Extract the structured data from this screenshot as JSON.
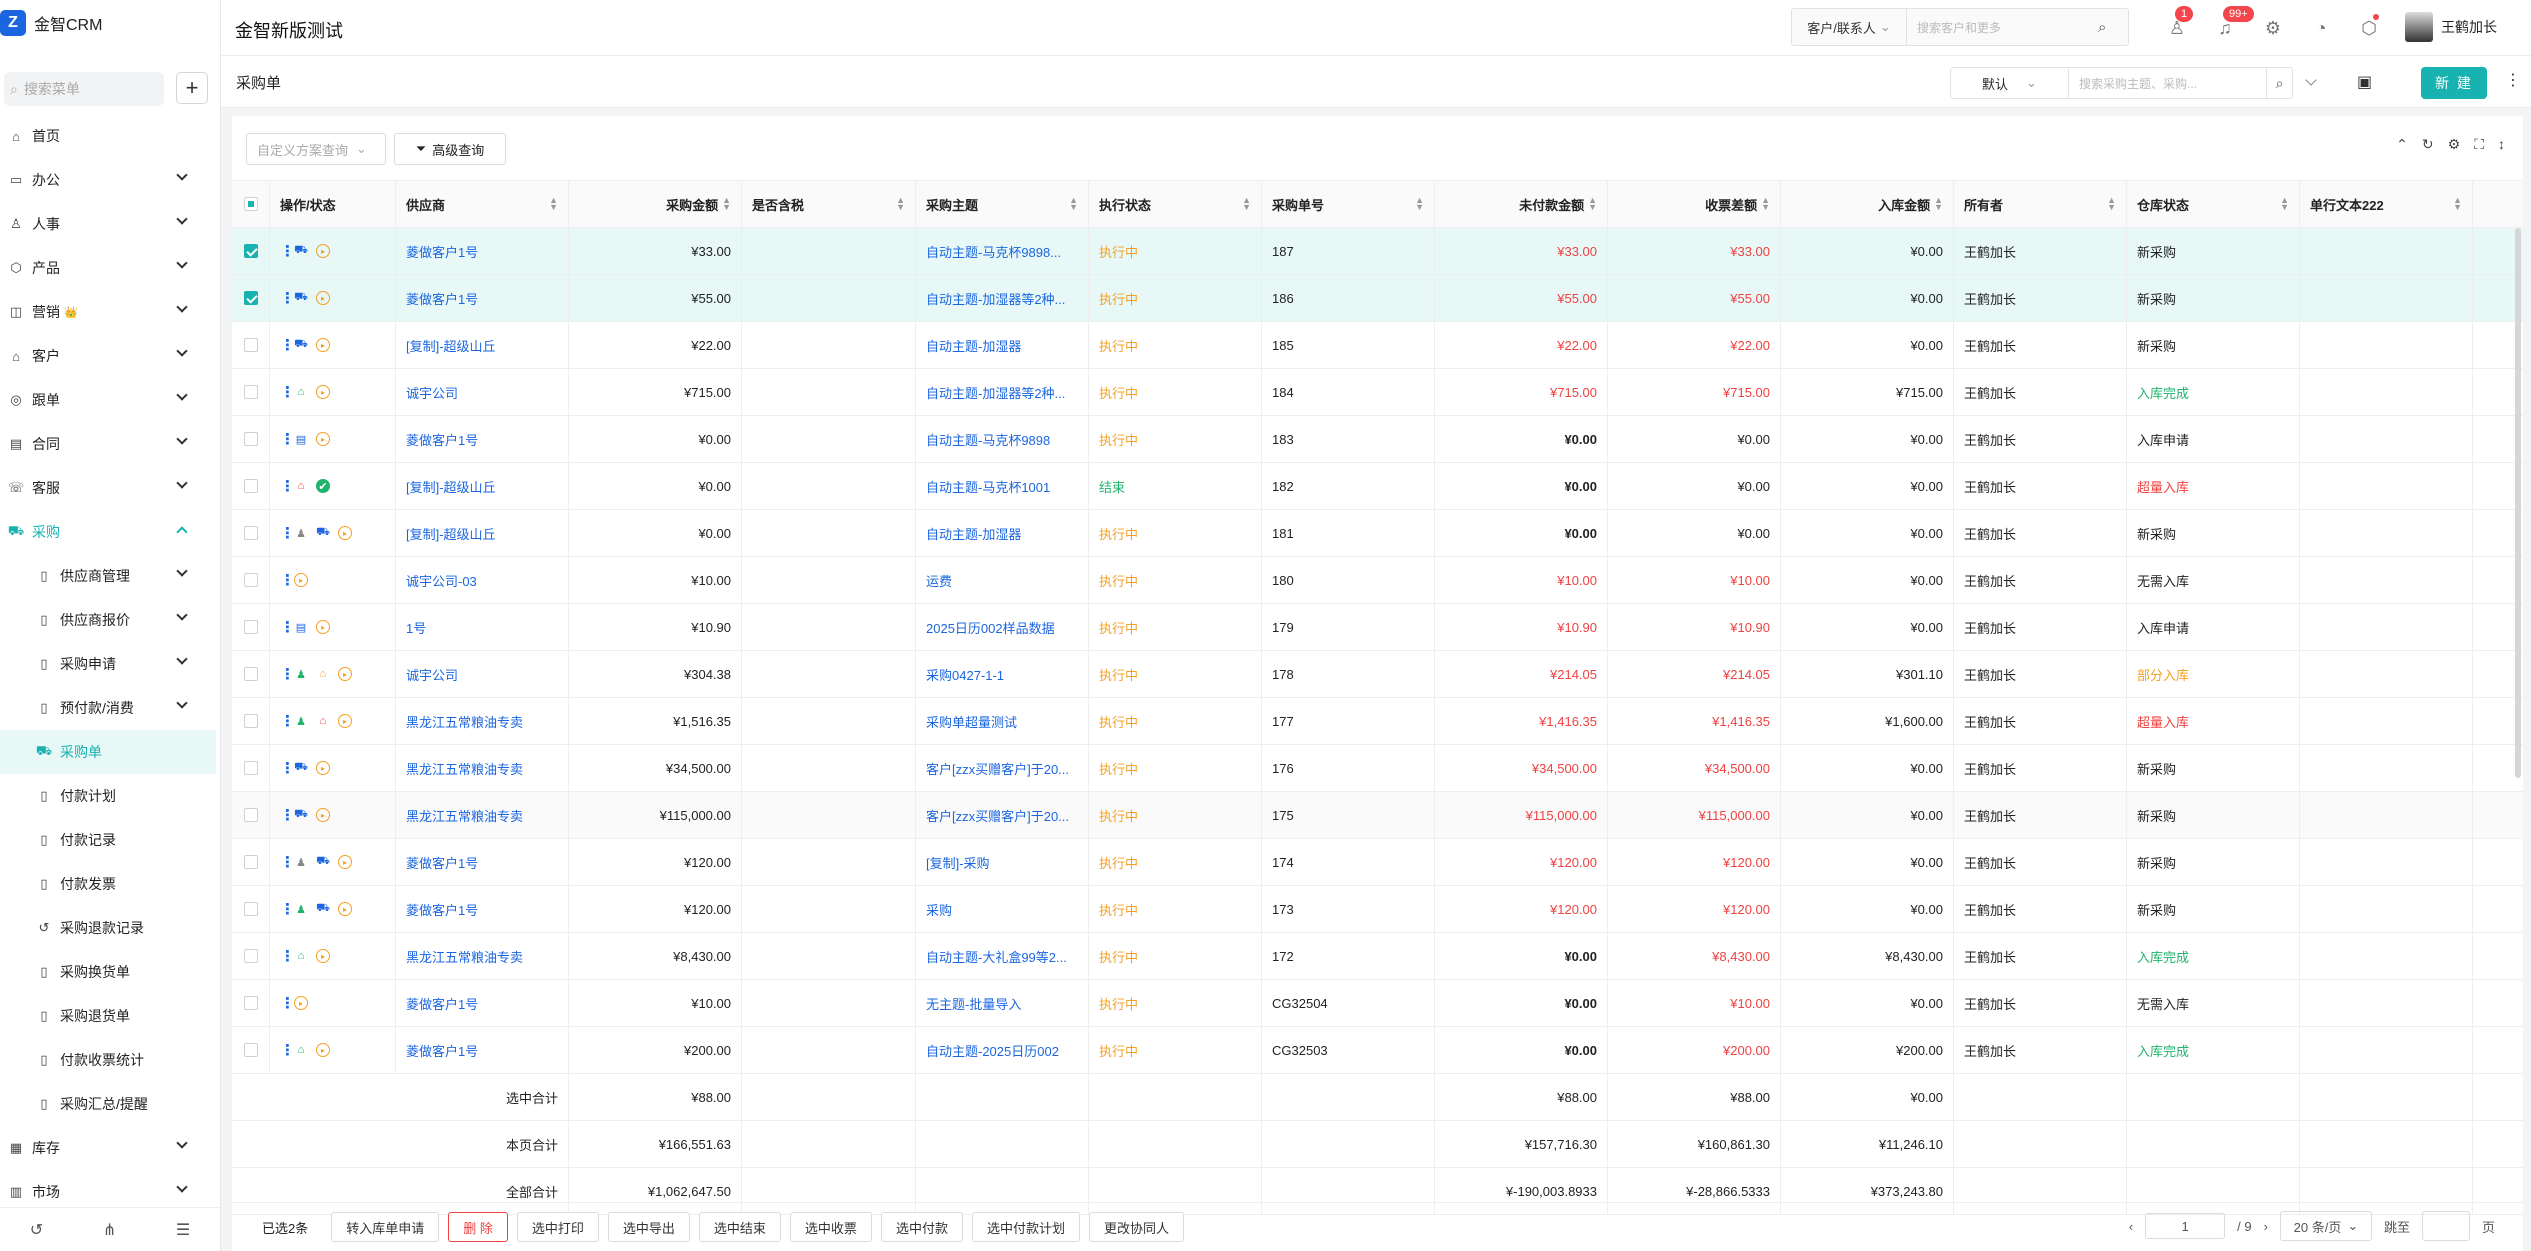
{
  "app": {
    "logo_letter": "Z",
    "name": "金智CRM",
    "title": "金智新版测试"
  },
  "sidebar": {
    "search_placeholder": "搜索菜单",
    "items": [
      {
        "label": "首页",
        "icon": "home-icon",
        "glyph": "⌂",
        "chevron": false
      },
      {
        "label": "办公",
        "icon": "office-icon",
        "glyph": "▭",
        "chevron": true
      },
      {
        "label": "人事",
        "icon": "people-icon",
        "glyph": "♙",
        "chevron": true
      },
      {
        "label": "产品",
        "icon": "box-icon",
        "glyph": "⬡",
        "chevron": true
      },
      {
        "label": "营销",
        "icon": "marketing-icon",
        "glyph": "◫",
        "chevron": true,
        "badge": "👑"
      },
      {
        "label": "客户",
        "icon": "customer-icon",
        "glyph": "⌂",
        "chevron": true
      },
      {
        "label": "跟单",
        "icon": "follow-icon",
        "glyph": "◎",
        "chevron": true
      },
      {
        "label": "合同",
        "icon": "contract-icon",
        "glyph": "▤",
        "chevron": true
      },
      {
        "label": "客服",
        "icon": "service-icon",
        "glyph": "☏",
        "chevron": true
      },
      {
        "label": "采购",
        "icon": "purchase-icon",
        "glyph": "⛟",
        "chevron": true,
        "open": true
      },
      {
        "label": "供应商管理",
        "icon": "supplier-icon",
        "glyph": "▯",
        "chevron": true,
        "sub": true
      },
      {
        "label": "供应商报价",
        "icon": "quote-icon",
        "glyph": "▯",
        "chevron": true,
        "sub": true
      },
      {
        "label": "采购申请",
        "icon": "apply-icon",
        "glyph": "▯",
        "chevron": true,
        "sub": true
      },
      {
        "label": "预付款/消费",
        "icon": "prepay-icon",
        "glyph": "▯",
        "chevron": true,
        "sub": true
      },
      {
        "label": "采购单",
        "icon": "order-icon",
        "glyph": "⛟",
        "chevron": false,
        "sub": true,
        "active": true
      },
      {
        "label": "付款计划",
        "icon": "plan-icon",
        "glyph": "▯",
        "chevron": false,
        "sub": true
      },
      {
        "label": "付款记录",
        "icon": "record-icon",
        "glyph": "▯",
        "chevron": false,
        "sub": true
      },
      {
        "label": "付款发票",
        "icon": "invoice-icon",
        "glyph": "▯",
        "chevron": false,
        "sub": true
      },
      {
        "label": "采购退款记录",
        "icon": "refund-icon",
        "glyph": "↺",
        "chevron": false,
        "sub": true
      },
      {
        "label": "采购换货单",
        "icon": "exchange-icon",
        "glyph": "▯",
        "chevron": false,
        "sub": true
      },
      {
        "label": "采购退货单",
        "icon": "return-icon",
        "glyph": "▯",
        "chevron": false,
        "sub": true
      },
      {
        "label": "付款收票统计",
        "icon": "stats-icon",
        "glyph": "▯",
        "chevron": false,
        "sub": true
      },
      {
        "label": "采购汇总/提醒",
        "icon": "summary-icon",
        "glyph": "▯",
        "chevron": false,
        "sub": true
      },
      {
        "label": "库存",
        "icon": "stock-icon",
        "glyph": "▦",
        "chevron": true
      },
      {
        "label": "市场",
        "icon": "market-icon",
        "glyph": "▥",
        "chevron": true
      }
    ],
    "bottom_icons": [
      "history-icon",
      "org-icon",
      "settings-list-icon"
    ]
  },
  "topbar": {
    "search_scope": "客户/联系人",
    "search_placeholder": "搜索客户和更多",
    "badge_contacts": "1",
    "badge_messages": "99+",
    "user_name": "王鹤加长"
  },
  "subheader": {
    "title": "采购单",
    "view": "默认",
    "search_placeholder": "搜索采购主题、采购...",
    "new_label": "新 建"
  },
  "query": {
    "scheme_placeholder": "自定义方案查询",
    "advanced_label": "高级查询"
  },
  "columns": [
    "操作/状态",
    "供应商",
    "采购金额",
    "是否含税",
    "采购主题",
    "执行状态",
    "采购单号",
    "未付款金额",
    "收票差额",
    "入库金额",
    "所有者",
    "仓库状态",
    "单行文本222"
  ],
  "rows": [
    {
      "checked": true,
      "ops": [
        "cart"
      ],
      "supplier": "菱做客户1号",
      "amount": "¥33.00",
      "tax": "",
      "subject": "自动主题-马克杯9898...",
      "exec": "执行中",
      "code": "187",
      "unpaid": "¥33.00",
      "diff": "¥33.00",
      "stock_amt": "¥0.00",
      "owner": "王鹤加长",
      "wh": "新采购",
      "wh_color": ""
    },
    {
      "checked": true,
      "ops": [
        "cart"
      ],
      "supplier": "菱做客户1号",
      "amount": "¥55.00",
      "tax": "",
      "subject": "自动主题-加湿器等2种...",
      "exec": "执行中",
      "code": "186",
      "unpaid": "¥55.00",
      "diff": "¥55.00",
      "stock_amt": "¥0.00",
      "owner": "王鹤加长",
      "wh": "新采购",
      "wh_color": ""
    },
    {
      "checked": false,
      "ops": [
        "cart"
      ],
      "supplier": "[复制]-超级山丘",
      "amount": "¥22.00",
      "tax": "",
      "subject": "自动主题-加湿器",
      "exec": "执行中",
      "code": "185",
      "unpaid": "¥22.00",
      "diff": "¥22.00",
      "stock_amt": "¥0.00",
      "owner": "王鹤加长",
      "wh": "新采购",
      "wh_color": ""
    },
    {
      "checked": false,
      "ops": [
        "house"
      ],
      "supplier": "诚宇公司",
      "amount": "¥715.00",
      "tax": "",
      "subject": "自动主题-加湿器等2种...",
      "exec": "执行中",
      "code": "184",
      "unpaid": "¥715.00",
      "diff": "¥715.00",
      "stock_amt": "¥715.00",
      "owner": "王鹤加长",
      "wh": "入库完成",
      "wh_color": "green"
    },
    {
      "checked": false,
      "ops": [
        "doc"
      ],
      "supplier": "菱做客户1号",
      "amount": "¥0.00",
      "tax": "",
      "subject": "自动主题-马克杯9898",
      "exec": "执行中",
      "code": "183",
      "unpaid": "¥0.00",
      "diff": "¥0.00",
      "stock_amt": "¥0.00",
      "owner": "王鹤加长",
      "wh": "入库申请",
      "wh_color": ""
    },
    {
      "checked": false,
      "ops": [
        "house-red"
      ],
      "supplier": "[复制]-超级山丘",
      "amount": "¥0.00",
      "tax": "",
      "subject": "自动主题-马克杯1001",
      "exec": "结束",
      "code": "182",
      "unpaid": "¥0.00",
      "diff": "¥0.00",
      "stock_amt": "¥0.00",
      "owner": "王鹤加长",
      "wh": "超量入库",
      "wh_color": "red",
      "done": true
    },
    {
      "checked": false,
      "ops": [
        "person-grey",
        "cart"
      ],
      "supplier": "[复制]-超级山丘",
      "amount": "¥0.00",
      "tax": "",
      "subject": "自动主题-加湿器",
      "exec": "执行中",
      "code": "181",
      "unpaid": "¥0.00",
      "diff": "¥0.00",
      "stock_amt": "¥0.00",
      "owner": "王鹤加长",
      "wh": "新采购",
      "wh_color": ""
    },
    {
      "checked": false,
      "ops": [],
      "supplier": "诚宇公司-03",
      "amount": "¥10.00",
      "tax": "",
      "subject": "运费",
      "exec": "执行中",
      "code": "180",
      "unpaid": "¥10.00",
      "diff": "¥10.00",
      "stock_amt": "¥0.00",
      "owner": "王鹤加长",
      "wh": "无需入库",
      "wh_color": ""
    },
    {
      "checked": false,
      "ops": [
        "doc"
      ],
      "supplier": "1号",
      "amount": "¥10.90",
      "tax": "",
      "subject": "2025日历002样品数据",
      "exec": "执行中",
      "code": "179",
      "unpaid": "¥10.90",
      "diff": "¥10.90",
      "stock_amt": "¥0.00",
      "owner": "王鹤加长",
      "wh": "入库申请",
      "wh_color": ""
    },
    {
      "checked": false,
      "ops": [
        "person-green",
        "house-orange"
      ],
      "supplier": "诚宇公司",
      "amount": "¥304.38",
      "tax": "",
      "subject": "采购0427-1-1",
      "exec": "执行中",
      "code": "178",
      "unpaid": "¥214.05",
      "diff": "¥214.05",
      "stock_amt": "¥301.10",
      "owner": "王鹤加长",
      "wh": "部分入库",
      "wh_color": "orange"
    },
    {
      "checked": false,
      "ops": [
        "person-green",
        "house-red"
      ],
      "supplier": "黑龙江五常粮油专卖",
      "amount": "¥1,516.35",
      "tax": "",
      "subject": "采购单超量测试",
      "exec": "执行中",
      "code": "177",
      "unpaid": "¥1,416.35",
      "diff": "¥1,416.35",
      "stock_amt": "¥1,600.00",
      "owner": "王鹤加长",
      "wh": "超量入库",
      "wh_color": "red"
    },
    {
      "checked": false,
      "ops": [
        "cart"
      ],
      "supplier": "黑龙江五常粮油专卖",
      "amount": "¥34,500.00",
      "tax": "",
      "subject": "客户[zzx买赠客户]于20...",
      "exec": "执行中",
      "code": "176",
      "unpaid": "¥34,500.00",
      "diff": "¥34,500.00",
      "stock_amt": "¥0.00",
      "owner": "王鹤加长",
      "wh": "新采购",
      "wh_color": ""
    },
    {
      "checked": false,
      "ops": [
        "cart"
      ],
      "supplier": "黑龙江五常粮油专卖",
      "amount": "¥115,000.00",
      "tax": "",
      "subject": "客户[zzx买赠客户]于20...",
      "exec": "执行中",
      "code": "175",
      "unpaid": "¥115,000.00",
      "diff": "¥115,000.00",
      "stock_amt": "¥0.00",
      "owner": "王鹤加长",
      "wh": "新采购",
      "wh_color": ""
    },
    {
      "checked": false,
      "ops": [
        "person-grey",
        "cart"
      ],
      "supplier": "菱做客户1号",
      "amount": "¥120.00",
      "tax": "",
      "subject": "[复制]-采购",
      "exec": "执行中",
      "code": "174",
      "unpaid": "¥120.00",
      "diff": "¥120.00",
      "stock_amt": "¥0.00",
      "owner": "王鹤加长",
      "wh": "新采购",
      "wh_color": ""
    },
    {
      "checked": false,
      "ops": [
        "person-green",
        "cart"
      ],
      "supplier": "菱做客户1号",
      "amount": "¥120.00",
      "tax": "",
      "subject": "采购",
      "exec": "执行中",
      "code": "173",
      "unpaid": "¥120.00",
      "diff": "¥120.00",
      "stock_amt": "¥0.00",
      "owner": "王鹤加长",
      "wh": "新采购",
      "wh_color": ""
    },
    {
      "checked": false,
      "ops": [
        "house"
      ],
      "supplier": "黑龙江五常粮油专卖",
      "amount": "¥8,430.00",
      "tax": "",
      "subject": "自动主题-大礼盒99等2...",
      "exec": "执行中",
      "code": "172",
      "unpaid": "¥0.00",
      "diff": "¥8,430.00",
      "stock_amt": "¥8,430.00",
      "owner": "王鹤加长",
      "wh": "入库完成",
      "wh_color": "green"
    },
    {
      "checked": false,
      "ops": [],
      "supplier": "菱做客户1号",
      "amount": "¥10.00",
      "tax": "",
      "subject": "无主题-批量导入",
      "exec": "执行中",
      "code": "CG32504",
      "unpaid": "¥0.00",
      "diff": "¥10.00",
      "stock_amt": "¥0.00",
      "owner": "王鹤加长",
      "wh": "无需入库",
      "wh_color": ""
    },
    {
      "checked": false,
      "ops": [
        "house"
      ],
      "supplier": "菱做客户1号",
      "amount": "¥200.00",
      "tax": "",
      "subject": "自动主题-2025日历002",
      "exec": "执行中",
      "code": "CG32503",
      "unpaid": "¥0.00",
      "diff": "¥200.00",
      "stock_amt": "¥200.00",
      "owner": "王鹤加长",
      "wh": "入库完成",
      "wh_color": "green"
    }
  ],
  "totals": [
    {
      "label": "选中合计",
      "amount": "¥88.00",
      "unpaid": "¥88.00",
      "diff": "¥88.00",
      "stock_amt": "¥0.00"
    },
    {
      "label": "本页合计",
      "amount": "¥166,551.63",
      "unpaid": "¥157,716.30",
      "diff": "¥160,861.30",
      "stock_amt": "¥11,246.10"
    },
    {
      "label": "全部合计",
      "amount": "¥1,062,647.50",
      "unpaid": "¥-190,003.8933",
      "diff": "¥-28,866.5333",
      "stock_amt": "¥373,243.80"
    }
  ],
  "bottom": {
    "selected_count": "已选2条",
    "buttons": [
      "转入库单申请",
      "删 除",
      "选中打印",
      "选中导出",
      "选中结束",
      "选中收票",
      "选中付款",
      "选中付款计划",
      "更改协同人"
    ],
    "page": "1",
    "page_total": "/ 9",
    "page_size": "20 条/页",
    "jump_label": "跳至",
    "page_suffix": "页"
  },
  "colors": {
    "accent": "#18b3b0",
    "link": "#1b66e0",
    "red": "#f04141",
    "orange": "#f5a022",
    "green": "#20b36c"
  }
}
